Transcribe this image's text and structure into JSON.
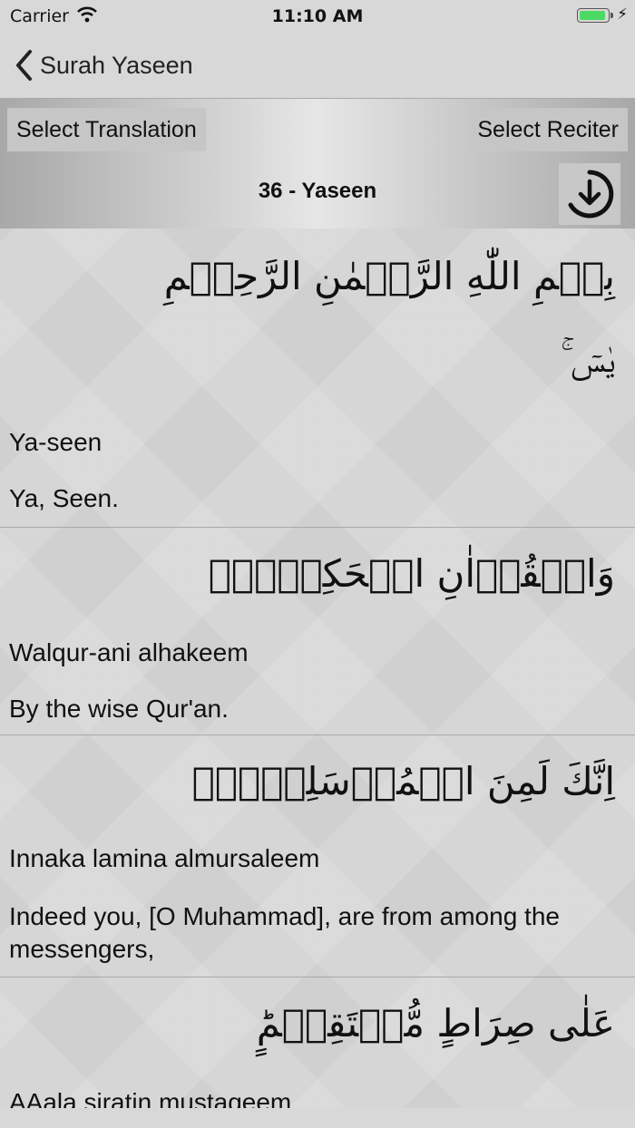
{
  "status_bar": {
    "carrier": "Carrier",
    "time": "11:10 AM",
    "battery_level": 1.0
  },
  "nav": {
    "back_label": "Surah Yaseen"
  },
  "toolbar": {
    "select_translation": "Select Translation",
    "select_reciter": "Select Reciter",
    "surah_title": "36 - Yaseen",
    "download_icon": "download-circle-icon"
  },
  "verses": [
    {
      "bismillah": "بِسۡمِ اللّٰهِ الرَّحۡمٰنِ الرَّحِيۡمِ",
      "arabic": "يٰسٓ‌ ۚ",
      "transliteration": "Ya-seen",
      "translation": "Ya, Seen."
    },
    {
      "arabic": "وَالۡقُرۡاٰنِ الۡحَكِيۡمِۙ",
      "transliteration": "Walqur-ani alhakeem",
      "translation": "By the wise Qur'an."
    },
    {
      "arabic": "اِنَّكَ لَمِنَ الۡمُرۡسَلِيۡنَۙ",
      "transliteration": "Innaka lamina almursaleem",
      "translation": "Indeed you, [O Muhammad], are from among the messengers,"
    },
    {
      "arabic": "عَلٰى صِرَاطٍ مُّسۡتَقِيۡمٍؕ",
      "transliteration": "AAala siratin mustaqeem",
      "translation": ""
    }
  ]
}
